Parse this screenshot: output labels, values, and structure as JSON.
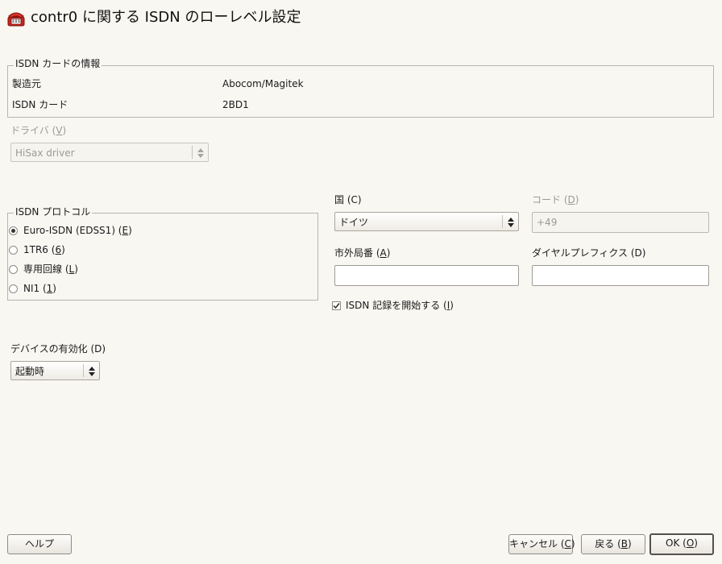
{
  "window": {
    "title": "contr0 に関する ISDN のローレベル設定",
    "icon": "phone-icon"
  },
  "card_info": {
    "legend": "ISDN カードの情報",
    "manufacturer_label": "製造元",
    "manufacturer_value": "Abocom/Magitek",
    "card_label": "ISDN カード",
    "card_value": "2BD1"
  },
  "driver": {
    "label_text": "ドライバ (",
    "label_key": "V",
    "label_close": ")",
    "value": "HiSax driver"
  },
  "protocol": {
    "legend": "ISDN プロトコル",
    "options": [
      {
        "text": "Euro-ISDN (EDSS1) (",
        "key": "E",
        "close": ")",
        "selected": true
      },
      {
        "text": "1TR6 (",
        "key": "6",
        "close": ")",
        "selected": false
      },
      {
        "text": "専用回線 (",
        "key": "L",
        "close": ")",
        "selected": false
      },
      {
        "text": "NI1 (",
        "key": "1",
        "close": ")",
        "selected": false
      }
    ]
  },
  "country": {
    "label_text": "国 (C)",
    "value": "ドイツ"
  },
  "code": {
    "label_text": "コード (",
    "label_key": "D",
    "label_close": ")",
    "value": "+49"
  },
  "area_code": {
    "label_text": "市外局番 (",
    "label_key": "A",
    "label_close": ")",
    "value": ""
  },
  "dial_prefix": {
    "label_text": "ダイヤルプレフィクス (D)",
    "value": ""
  },
  "isdn_log": {
    "label_text": "ISDN 記録を開始する (",
    "label_key": "I",
    "label_close": ")",
    "checked": true
  },
  "device_activation": {
    "label_text": "デバイスの有効化 (D)",
    "value": "起動時"
  },
  "buttons": {
    "help": "ヘルプ",
    "cancel_text": "キャンセル (",
    "cancel_key": "C",
    "cancel_close": ")",
    "back_text": "戻る (",
    "back_key": "B",
    "back_close": ")",
    "ok_text": "OK (",
    "ok_key": "O",
    "ok_close": ")"
  }
}
